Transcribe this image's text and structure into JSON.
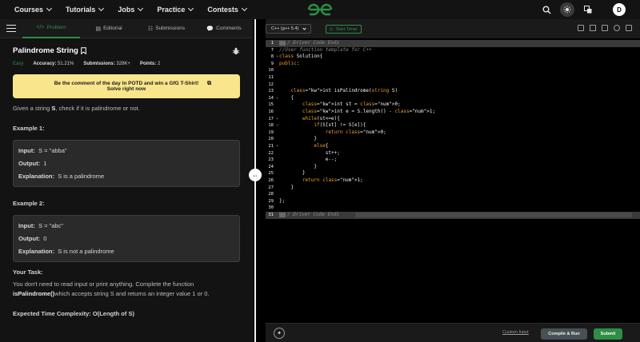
{
  "nav": {
    "items": [
      "Courses",
      "Tutorials",
      "Jobs",
      "Practice",
      "Contests"
    ],
    "avatar_initial": "D"
  },
  "tabs": {
    "problem": "Problem",
    "editorial": "Editorial",
    "submissions": "Submissions",
    "comments": "Comments"
  },
  "problem": {
    "title": "Palindrome String",
    "difficulty": "Easy",
    "accuracy_label": "Accuracy:",
    "accuracy": "51.21%",
    "submissions_label": "Submissions:",
    "submissions": "328K+",
    "points_label": "Points:",
    "points": "2",
    "potd_line1": "Be the comment of the day in POTD and win a GfG T-Shirt!",
    "potd_line2": "Solve right now",
    "statement_pre": "Given a string ",
    "statement_var": "S",
    "statement_post": ", check if it is palindrome or not.",
    "example1_title": "Example 1:",
    "example1": {
      "input_label": "Input:",
      "input": "S = \"abba\"",
      "output_label": "Output:",
      "output": "1",
      "expl_label": "Explanation:",
      "expl": "S is a palindrome"
    },
    "example2_title": "Example 2:",
    "example2": {
      "input_label": "Input:",
      "input": "S = \"abc\"",
      "output_label": "Output:",
      "output": "0",
      "expl_label": "Explanation:",
      "expl": "S is not a palindrome"
    },
    "task_title": "Your Task:",
    "task_pre": "You don't need to read input or print anything. Complete the function ",
    "task_fn": "isPalindrome()",
    "task_post": "which accepts string S and returns an integer value 1 or 0.",
    "complexity": "Expected Time Complexity: O(Length of S)"
  },
  "editor": {
    "language": "C++ (g++ 5.4)",
    "timer": "Start Timer",
    "custom_input": "Custom Input",
    "compile": "Compile & Run",
    "submit": "Submit",
    "lines": [
      {
        "n": "1",
        "t": "/ Driver Code Ends"
      },
      {
        "n": "7",
        "t": "//User function template for C++"
      },
      {
        "n": "8",
        "t": "class Solution{"
      },
      {
        "n": "9",
        "t": "public:"
      },
      {
        "n": "10",
        "t": ""
      },
      {
        "n": "11",
        "t": ""
      },
      {
        "n": "12",
        "t": ""
      },
      {
        "n": "13",
        "t": "    int isPalindrome(string S)"
      },
      {
        "n": "14",
        "t": "    {"
      },
      {
        "n": "15",
        "t": "        int st = 0;"
      },
      {
        "n": "16",
        "t": "        int e = S.length() - 1;"
      },
      {
        "n": "17",
        "t": "        while(st<=e){"
      },
      {
        "n": "18",
        "t": "            if(S[st] != S[e]){"
      },
      {
        "n": "19",
        "t": "                return 0;"
      },
      {
        "n": "20",
        "t": "            }"
      },
      {
        "n": "21",
        "t": "            else{"
      },
      {
        "n": "22",
        "t": "                st++;"
      },
      {
        "n": "23",
        "t": "                e--;"
      },
      {
        "n": "24",
        "t": "            }"
      },
      {
        "n": "25",
        "t": "        }"
      },
      {
        "n": "26",
        "t": "        return 1;"
      },
      {
        "n": "27",
        "t": "    }"
      },
      {
        "n": "28",
        "t": ""
      },
      {
        "n": "29",
        "t": "};"
      },
      {
        "n": "30",
        "t": ""
      },
      {
        "n": "31",
        "t": "/ Driver Code Ends"
      }
    ]
  },
  "colors": {
    "accent": "#2f8d46",
    "potd_bg": "#f8e58c",
    "keyword": "#f0a030"
  }
}
